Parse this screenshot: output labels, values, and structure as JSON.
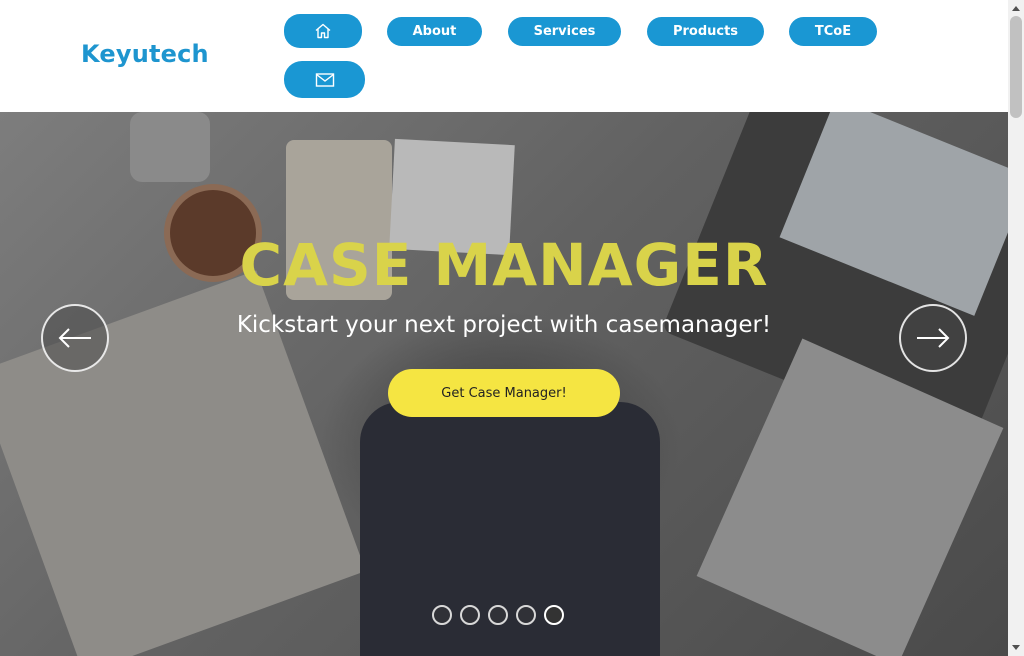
{
  "brand": {
    "name": "Keyutech",
    "color": "#1e95cf"
  },
  "nav": {
    "home_icon": "home-icon",
    "items": [
      {
        "label": "About"
      },
      {
        "label": "Services"
      },
      {
        "label": "Products"
      },
      {
        "label": "TCoE"
      }
    ],
    "mail_icon": "mail-icon",
    "button_color": "#1a97d3"
  },
  "hero": {
    "title": "CASE MANAGER",
    "subtitle": "Kickstart your next project with casemanager!",
    "cta_label": "Get Case Manager!",
    "title_color": "#d9d34a",
    "cta_color": "#f5e542",
    "prev_icon": "arrow-left-icon",
    "next_icon": "arrow-right-icon",
    "slides_count": 5,
    "active_slide": 5
  }
}
